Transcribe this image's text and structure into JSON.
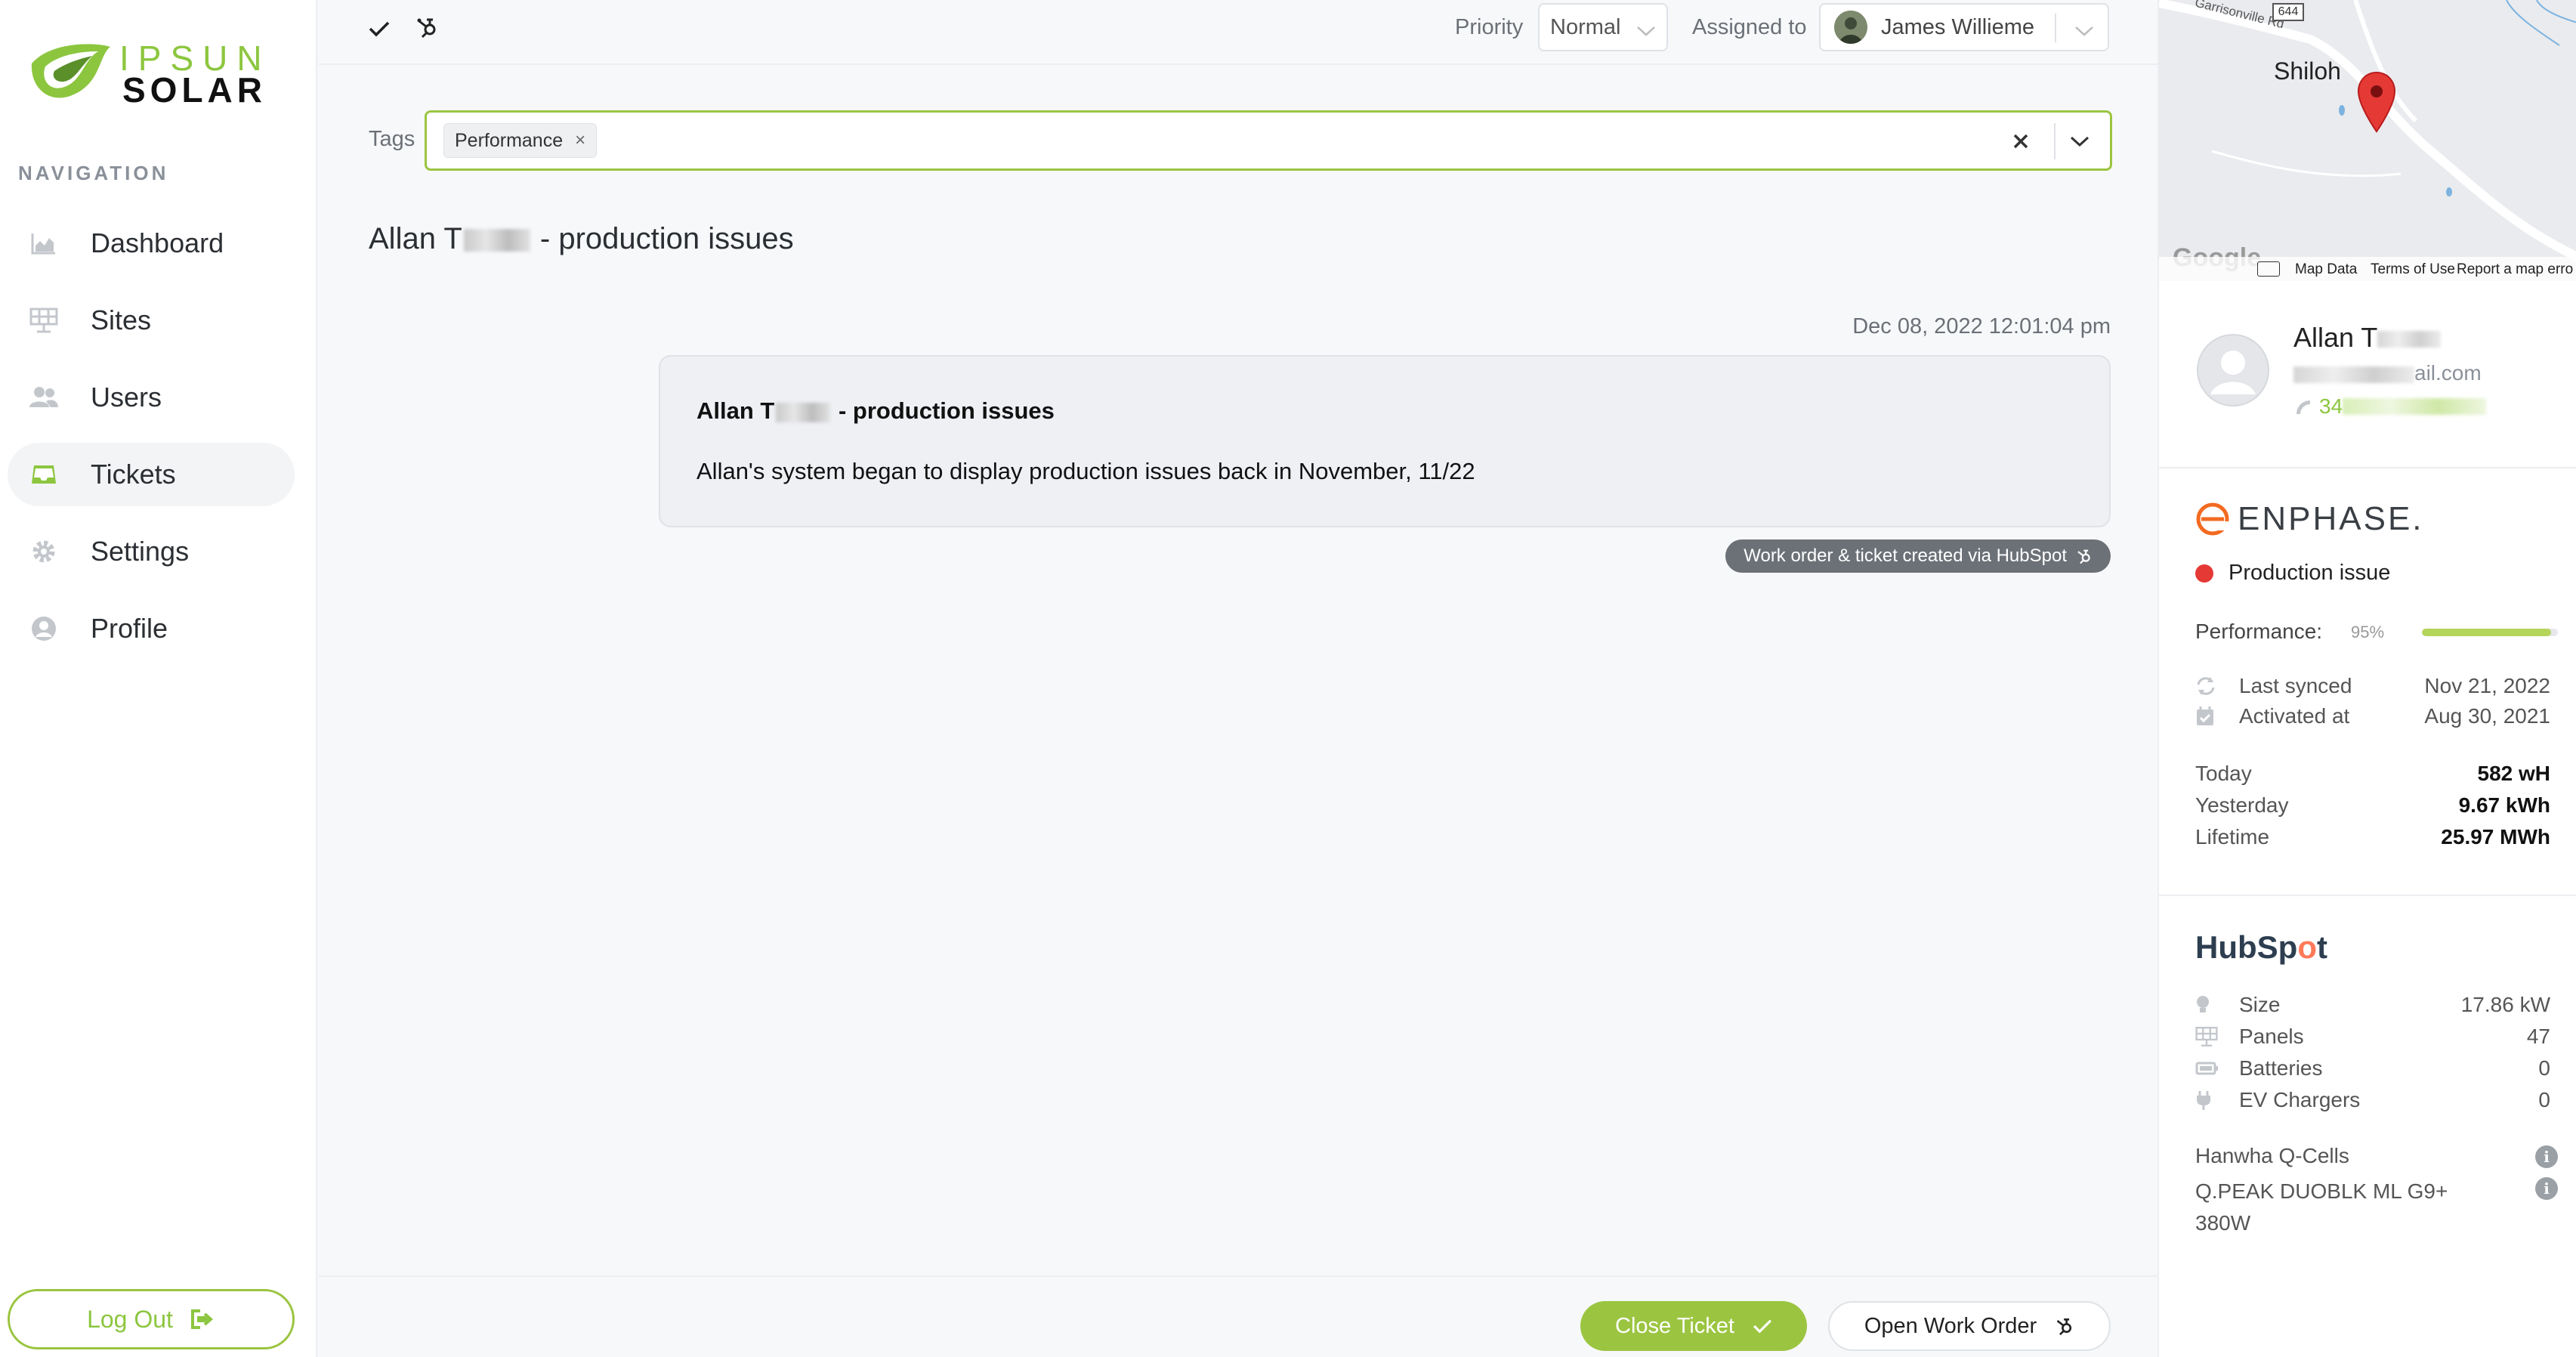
{
  "brand": {
    "top": "IPSUN",
    "bottom": "SOLAR",
    "accent": "#8cc63f"
  },
  "sidebar": {
    "heading": "NAVIGATION",
    "items": [
      {
        "label": "Dashboard",
        "icon": "chart-icon"
      },
      {
        "label": "Sites",
        "icon": "solar-panel-icon"
      },
      {
        "label": "Users",
        "icon": "users-icon"
      },
      {
        "label": "Tickets",
        "icon": "inbox-icon",
        "active": true
      },
      {
        "label": "Settings",
        "icon": "gear-icon"
      },
      {
        "label": "Profile",
        "icon": "user-circle-icon"
      }
    ],
    "logout": "Log Out"
  },
  "topbar": {
    "priority_label": "Priority",
    "priority_value": "Normal",
    "assigned_label": "Assigned to",
    "assignee": "James Willieme"
  },
  "tags": {
    "label": "Tags",
    "items": [
      "Performance"
    ]
  },
  "ticket": {
    "title_prefix": "Allan T",
    "title_suffix": "- production issues",
    "date": "Dec 08, 2022 12:01:04 pm",
    "message_subject_prefix": "Allan T",
    "message_subject_suffix": "- production issues",
    "message_body": "Allan's system began to display production issues back in November, 11/22",
    "via_badge": "Work order & ticket created via HubSpot"
  },
  "footer": {
    "close_ticket": "Close Ticket",
    "open_work_order": "Open Work Order"
  },
  "map": {
    "road": "Garrisonville Rd",
    "shield": "644",
    "town": "Shiloh",
    "google": "Google",
    "map_data": "Map Data",
    "terms": "Terms of Use",
    "report": "Report a map erro"
  },
  "contact": {
    "name_prefix": "Allan T",
    "email_suffix": "ail.com",
    "phone_prefix": "34"
  },
  "enphase": {
    "logo": "ENPHASE.",
    "status": "Production issue",
    "status_color": "#e53935",
    "performance_label": "Performance:",
    "performance_pct": "95%",
    "performance_fraction": 0.95,
    "last_synced_label": "Last synced",
    "last_synced": "Nov 21, 2022",
    "activated_label": "Activated at",
    "activated": "Aug 30, 2021",
    "today_label": "Today",
    "today": "582 wH",
    "yesterday_label": "Yesterday",
    "yesterday": "9.67 kWh",
    "lifetime_label": "Lifetime",
    "lifetime": "25.97 MWh"
  },
  "hubspot": {
    "logo_a": "HubSp",
    "logo_o": "o",
    "logo_b": "t",
    "size_label": "Size",
    "size": "17.86 kW",
    "panels_label": "Panels",
    "panels": "47",
    "batteries_label": "Batteries",
    "batteries": "0",
    "ev_label": "EV Chargers",
    "ev": "0",
    "manufacturer": "Hanwha Q-Cells",
    "model": "Q.PEAK DUOBLK ML G9+ 380W"
  }
}
